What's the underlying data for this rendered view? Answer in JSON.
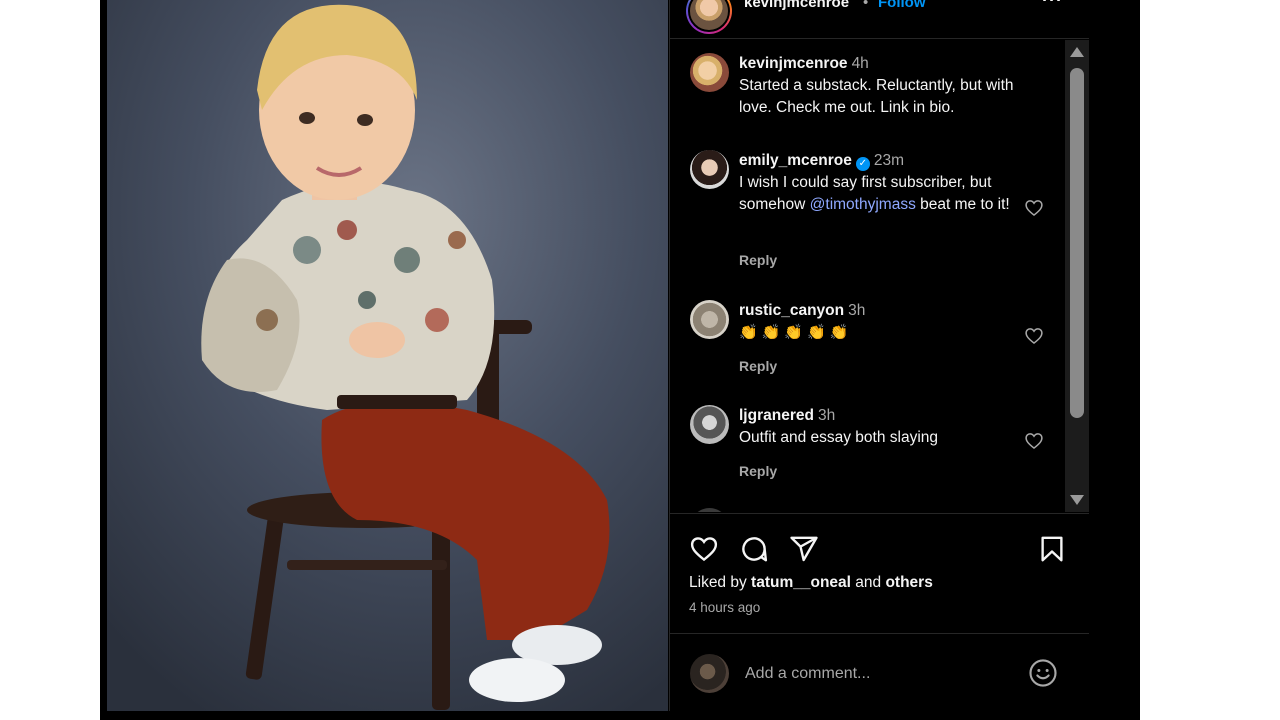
{
  "post": {
    "author": "kevinjmcenroe",
    "separator": "•",
    "follow_label": "Follow",
    "more_label": "···"
  },
  "comments": [
    {
      "username": "kevinjmcenroe",
      "time": "4h",
      "text": "Started a substack. Reluctantly, but with love. Check me out. Link in bio.",
      "verified": false
    },
    {
      "username": "emily_mcenroe",
      "time": "23m",
      "text_before": "I wish I could say first subscriber, but somehow ",
      "mention": "@timothyjmass",
      "text_after": " beat me to it!",
      "verified": true,
      "reply_label": "Reply"
    },
    {
      "username": "rustic_canyon",
      "time": "3h",
      "text": "👏👏👏👏👏",
      "verified": false,
      "reply_label": "Reply"
    },
    {
      "username": "ljgranered",
      "time": "3h",
      "text": "Outfit and essay both slaying",
      "verified": false,
      "reply_label": "Reply"
    }
  ],
  "likes": {
    "prefix": "Liked by ",
    "user": "tatum__oneal",
    "middle": " and ",
    "others": "others"
  },
  "posted_ago": "4 hours ago",
  "add_comment": {
    "placeholder": "Add a comment..."
  },
  "icons": {
    "like": "heart-icon",
    "comment": "comment-icon",
    "share": "share-icon",
    "save": "bookmark-icon",
    "emoji": "emoji-icon",
    "more": "more-icon"
  },
  "colors": {
    "background": "#000000",
    "link": "#0095f6",
    "mention": "#8fa8ff",
    "secondary_text": "#a8a8a8"
  }
}
